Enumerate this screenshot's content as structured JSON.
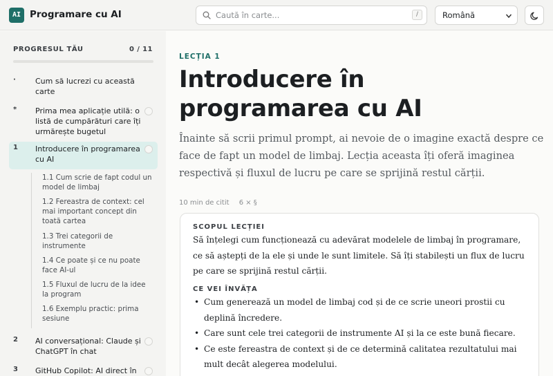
{
  "header": {
    "logo_text": "AI",
    "title": "Programare cu AI",
    "search_placeholder": "Caută în carte...",
    "search_shortcut": "/",
    "language": "Română",
    "theme_icon": "moon-icon"
  },
  "sidebar": {
    "progress_label": "PROGRESUL TĂU",
    "progress_count": "0 / 11",
    "progress_value": 0,
    "items": [
      {
        "marker": "·",
        "label": "Cum să lucrezi cu această carte",
        "checkbox": false,
        "active": false
      },
      {
        "marker": "*",
        "label": "Prima mea aplicație utilă: o listă de cumpărături care îți urmărește bugetul",
        "checkbox": true,
        "active": false
      },
      {
        "marker": "1",
        "label": "Introducere în programarea cu AI",
        "checkbox": true,
        "active": true
      },
      {
        "marker": "2",
        "label": "AI conversațional: Claude și ChatGPT în chat",
        "checkbox": true,
        "active": false
      },
      {
        "marker": "3",
        "label": "GitHub Copilot: AI direct în",
        "checkbox": true,
        "active": false
      }
    ],
    "subsections": [
      "1.1  Cum scrie de fapt codul un model de limbaj",
      "1.2  Fereastra de context: cel mai important concept din toată cartea",
      "1.3  Trei categorii de instrumente",
      "1.4  Ce poate și ce nu poate face AI-ul",
      "1.5  Fluxul de lucru de la idee la program",
      "1.6  Exemplu practic: prima sesiune"
    ]
  },
  "main": {
    "eyebrow": "LECȚIA 1",
    "title": "Introducere în programarea cu AI",
    "lead": "Înainte să scrii primul prompt, ai nevoie de o imagine exactă despre ce face de fapt un model de limbaj. Lecția aceasta îți oferă imaginea respectivă și fluxul de lucru pe care se sprijină restul cărții.",
    "meta_time": "10 min de citit",
    "meta_sections": "6 × §",
    "card": {
      "scope_heading": "SCOPUL LECȚIEI",
      "scope_text": "Să înțelegi cum funcționează cu adevărat modelele de limbaj în programare, ce să aștepți de la ele și unde le sunt limitele. Să îți stabilești un flux de lucru pe care se sprijină restul cărții.",
      "learn_heading": "CE VEI ÎNVĂȚA",
      "learn_items": [
        "Cum generează un model de limbaj cod și de ce scrie uneori prostii cu deplină încredere.",
        "Care sunt cele trei categorii de instrumente AI și la ce este bună fiecare.",
        "Ce este fereastra de context și de ce determină calitatea rezultatului mai mult decât alegerea modelului."
      ]
    }
  }
}
